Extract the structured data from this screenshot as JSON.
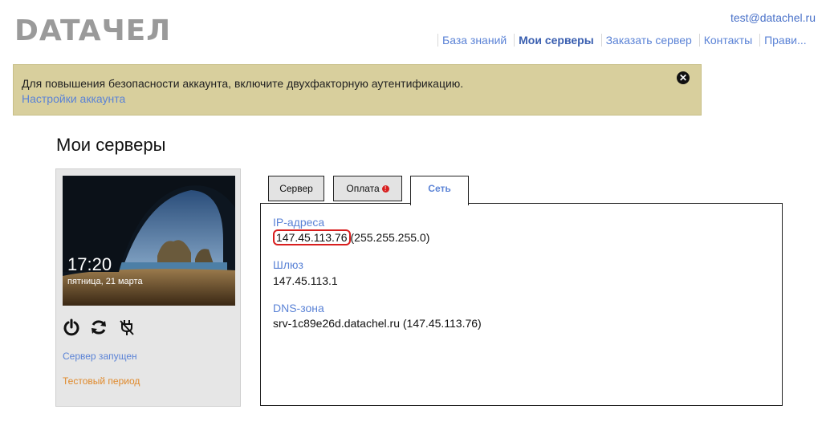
{
  "header": {
    "logo_text": "DATAЧЕЛ",
    "user_email": "test@datachel.ru",
    "nav": [
      "База знаний",
      "Мои серверы",
      "Заказать сервер",
      "Контакты",
      "Прави..."
    ],
    "active_nav": "Мои серверы"
  },
  "alert": {
    "message": "Для повышения безопасности аккаунта, включите двухфакторную аутентификацию.",
    "link": "Настройки аккаунта",
    "close_icon": "close-circle-icon"
  },
  "page_title": "Мои серверы",
  "server": {
    "screen_time": "17:20",
    "screen_date": "пятница, 21 марта",
    "controls": [
      "power-icon",
      "restart-icon",
      "plug-off-icon"
    ],
    "status": "Сервер запущен",
    "trial": "Тестовый период"
  },
  "tabs": {
    "server": "Сервер",
    "payment": "Оплата",
    "payment_badge": "!",
    "network": "Сеть"
  },
  "network": {
    "ip_label": "IP-адреса",
    "ip": "147.45.113.76",
    "mask": "(255.255.255.0)",
    "gateway_label": "Шлюз",
    "gateway": "147.45.113.1",
    "dns_label": "DNS-зона",
    "dns": "srv-1c89e26d.datachel.ru (147.45.113.76)"
  },
  "colors": {
    "accent": "#5b83d6",
    "alert_bg": "#d8cf9d",
    "trial": "#e0892a",
    "highlight": "#d81e1e"
  }
}
